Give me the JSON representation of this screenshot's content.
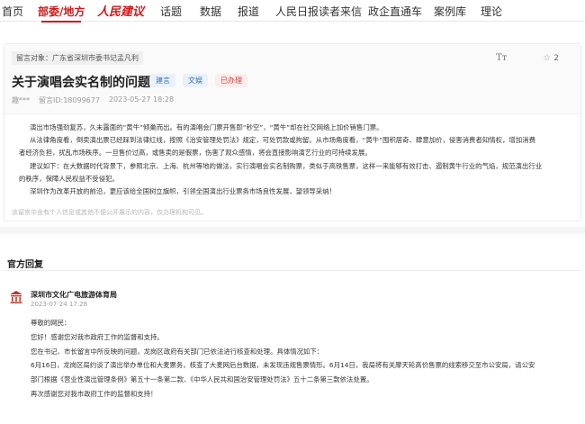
{
  "nav": {
    "items": [
      "首页",
      "部委/地方",
      "话题",
      "数据",
      "报道",
      "人民日报读者来信",
      "政企直通车",
      "案例库",
      "理论"
    ],
    "logo": "人民建议",
    "active": "部委/地方"
  },
  "message": {
    "target": "留言对象：广东省深圳市委书记孟凡利",
    "font_tool": "Tт",
    "favorites": "2",
    "title": "关于演唱会实名制的问题",
    "tags": [
      "建言",
      "文娱",
      "已办理"
    ],
    "author": "趣***",
    "id": "留言ID:18099677",
    "date": "2023-05-27 18:28",
    "paragraphs": [
      "演出市场强劲复苏，久未露面的“黄牛”倾巢而出。有的演唱会门票开售即“秒空”，“黄牛”却在社交网络上加价销售门票。",
      "从法律角度看，倒卖演出票已经踩到法律红线，按照《治安管理处罚法》规定，可处罚款或拘留。从市场角度看，“黄牛”囤积居奇、肆意加价，侵害消费者知情权，增加消费",
      "者经济负担，扰乱市场秩序。一旦售价过高，或售卖的是假票，伤害了观众感情，将会直接影响演艺行业的可持续发展。",
      "建议如下：在大数据时代背景下，参照北京、上海、杭州等地的做法，实行演唱会实名制购票，类似于高铁售票，这样一来能够有效打击、遏制黄牛行业的气焰，规范演出行业",
      "的秩序，保障人民权益不受侵犯。",
      "深圳作为改革开放的前沿，更应该给全国树立旗帜，引领全国演出行业票务市场良性发展，望领导采纳！"
    ],
    "disclaimer": "该留言中含有个人信息或其他不便公开展示的内容，仅办理机构可见。"
  },
  "reply": {
    "section_title": "官方回复",
    "org": "深圳市文化广电旅游体育局",
    "date": "2023-07-24 17:28",
    "lines": [
      "尊敬的网民：",
      "您好！感谢您对我市政府工作的监督和支持。",
      "您在书记、市长留言中所反映的问题，龙岗区政府有关部门已依法进行核查和处理。具体情况如下：",
      "6月16日，龙岗区局约谈了演出举办单位和大麦票务，核查了大麦网后台数据，未发现违规售票情形。6月14日，我局将有关摩天轮高价售票的线索移交至市公安局，请公安",
      "部门根据《营业性演出管理条例》第五十一条第二款、《中华人民共和国治安管理处罚法》五十二条第三款依法处置。",
      "再次感谢您对我市政府工作的监督和支持！"
    ]
  },
  "colors": {
    "accent": "#d01a1a",
    "tag_blue": "#3a6fb5",
    "tag_red": "#d23b3b"
  }
}
